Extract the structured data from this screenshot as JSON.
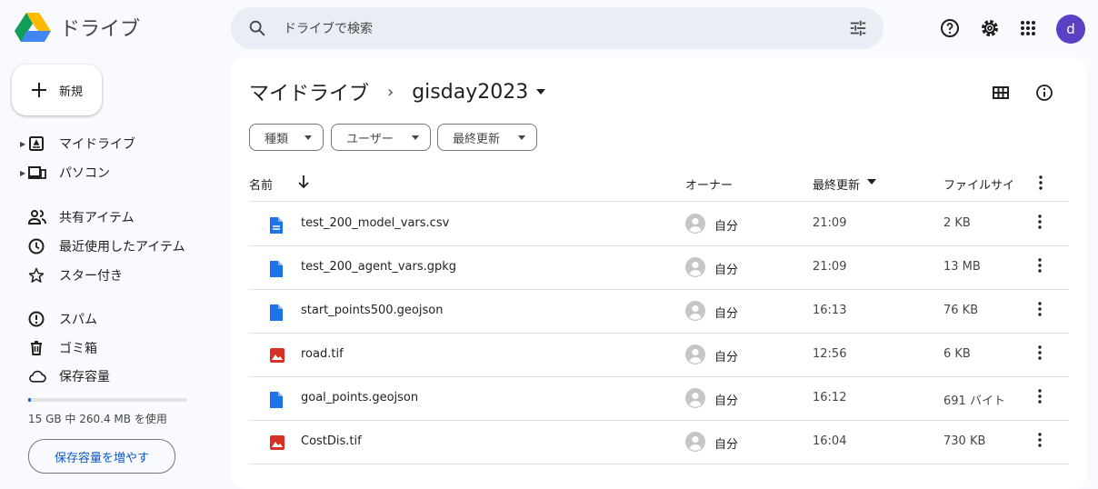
{
  "app": {
    "name": "ドライブ",
    "account_initial": "d"
  },
  "search": {
    "placeholder": "ドライブで検索"
  },
  "icons": {
    "search": "search-icon",
    "tune": "tune-icon",
    "help": "help-icon",
    "settings": "gear-icon",
    "apps": "apps-grid-icon"
  },
  "sidebar": {
    "new_label": "新規",
    "items": [
      {
        "label": "マイドライブ",
        "icon": "my-drive-icon"
      },
      {
        "label": "パソコン",
        "icon": "computer-icon"
      },
      {
        "label": "共有アイテム",
        "icon": "shared-icon"
      },
      {
        "label": "最近使用したアイテム",
        "icon": "clock-icon"
      },
      {
        "label": "スター付き",
        "icon": "star-icon"
      },
      {
        "label": "スパム",
        "icon": "spam-icon"
      },
      {
        "label": "ゴミ箱",
        "icon": "trash-icon"
      },
      {
        "label": "保存容量",
        "icon": "cloud-icon"
      }
    ],
    "storage_text": "15 GB 中 260.4 MB を使用",
    "storage_fraction": 0.017,
    "storage_button": "保存容量を増やす"
  },
  "main": {
    "breadcrumb": [
      "マイドライブ",
      "gisday2023"
    ],
    "breadcrumb_separator": "›",
    "filters": [
      "種類",
      "ユーザー",
      "最終更新"
    ],
    "columns": {
      "name": "名前",
      "owner": "オーナー",
      "modified": "最終更新",
      "size": "ファイルサイ"
    },
    "files": [
      {
        "name": "test_200_model_vars.csv",
        "type": "doc",
        "owner": "自分",
        "modified": "21:09",
        "size": "2 KB"
      },
      {
        "name": "test_200_agent_vars.gpkg",
        "type": "file",
        "owner": "自分",
        "modified": "21:09",
        "size": "13 MB"
      },
      {
        "name": "start_points500.geojson",
        "type": "file",
        "owner": "自分",
        "modified": "16:13",
        "size": "76 KB"
      },
      {
        "name": "road.tif",
        "type": "image",
        "owner": "自分",
        "modified": "12:56",
        "size": "6 KB"
      },
      {
        "name": "goal_points.geojson",
        "type": "file",
        "owner": "自分",
        "modified": "16:12",
        "size": "691 バイト"
      },
      {
        "name": "CostDis.tif",
        "type": "image",
        "owner": "自分",
        "modified": "16:04",
        "size": "730 KB"
      }
    ]
  },
  "colors": {
    "accent": "#0b57d0",
    "avatar": "#5b3fc4",
    "doc_blue": "#1a73e8",
    "image_red": "#d93025"
  }
}
